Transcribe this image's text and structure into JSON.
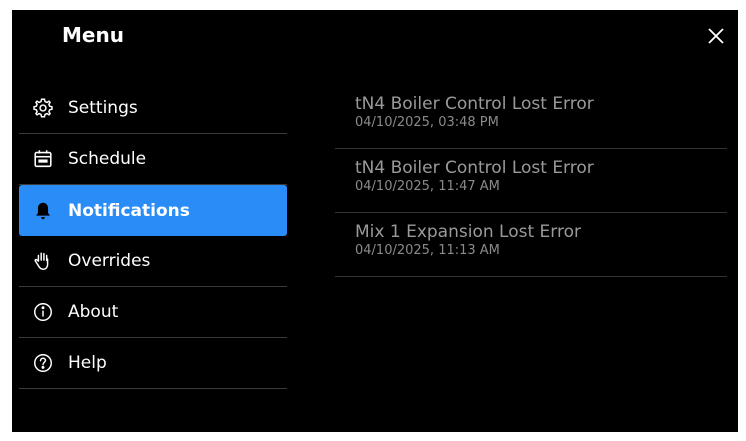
{
  "menu": {
    "title": "Menu",
    "close_icon": "close-icon"
  },
  "nav": {
    "items": [
      {
        "label": "Settings",
        "icon": "gear-icon"
      },
      {
        "label": "Schedule",
        "icon": "calendar-icon"
      },
      {
        "label": "Notifications",
        "icon": "bell-icon",
        "active": true
      },
      {
        "label": "Overrides",
        "icon": "hand-icon"
      },
      {
        "label": "About",
        "icon": "info-icon"
      },
      {
        "label": "Help",
        "icon": "help-icon"
      }
    ]
  },
  "notifications": [
    {
      "title": "tN4 Boiler Control Lost Error",
      "time": "04/10/2025, 03:48 PM"
    },
    {
      "title": "tN4 Boiler Control Lost Error",
      "time": "04/10/2025, 11:47 AM"
    },
    {
      "title": "Mix 1 Expansion Lost Error",
      "time": "04/10/2025, 11:13 AM"
    }
  ],
  "colors": {
    "accent": "#2a8cf6",
    "background": "#000000",
    "text": "#ffffff",
    "muted": "#9a9a9a"
  }
}
